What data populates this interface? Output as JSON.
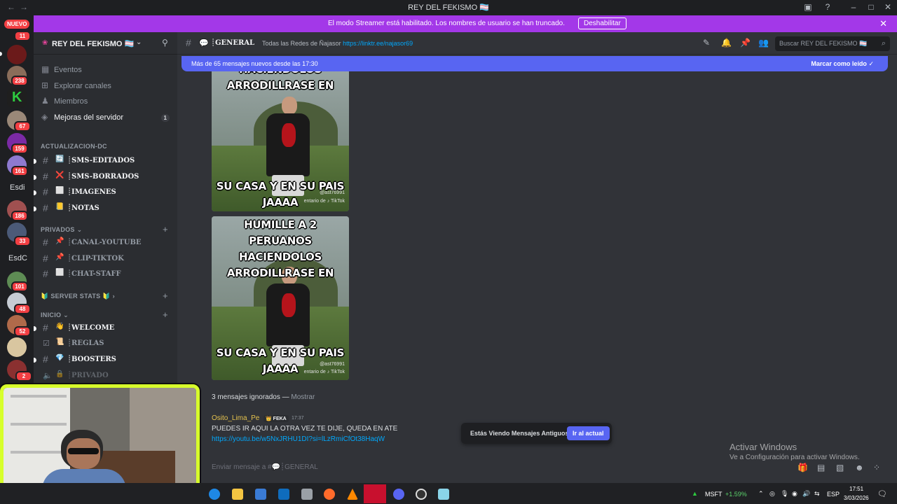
{
  "window": {
    "title": "REY DEL FEKISMO 🏳️‍⚧️"
  },
  "streamer_banner": {
    "message": "El modo Streamer está habilitado. Los nombres de usuario se han truncado.",
    "button": "Deshabilitar"
  },
  "guilds": {
    "new_label": "NUEVO",
    "badges": [
      "11",
      "238",
      "67",
      "159",
      "161",
      "186",
      "33",
      "101",
      "48",
      "52",
      "2"
    ],
    "text_icons": [
      "Esdi",
      "EsdC"
    ]
  },
  "server": {
    "name": "REY DEL FEKISMO 🏳️‍⚧️",
    "menu": [
      {
        "label": "Eventos",
        "icon": "calendar-icon"
      },
      {
        "label": "Explorar canales",
        "icon": "compass-icon"
      },
      {
        "label": "Miembros",
        "icon": "members-icon"
      },
      {
        "label": "Mejoras del servidor",
        "icon": "boost-icon",
        "badge": "1"
      }
    ],
    "categories": {
      "actualizacion": "ACTUALIZACION-DC",
      "privados": "PRIVADOS",
      "server_stats": "SERVER STATS",
      "inicio": "INICIO"
    },
    "channels_actualizacion": [
      {
        "emoji": "🔄",
        "label": "┊SMS-EDITADOS"
      },
      {
        "emoji": "❌",
        "label": "┊SMS-BORRADOS"
      },
      {
        "emoji": "⬜",
        "label": "┊IMAGENES"
      },
      {
        "emoji": "📒",
        "label": "┊NOTAS"
      }
    ],
    "channels_privados": [
      {
        "emoji": "📌",
        "label": "┊CANAL-YOUTUBE"
      },
      {
        "emoji": "📌",
        "label": "┊CLIP-TIKTOK"
      },
      {
        "emoji": "⬜",
        "label": "┊CHAT-STAFF"
      }
    ],
    "channels_inicio": [
      {
        "emoji": "👋",
        "label": "┊WELCOME"
      },
      {
        "emoji": "📜",
        "label": "┊REGLAS"
      },
      {
        "emoji": "💎",
        "label": "┊BOOSTERS"
      },
      {
        "emoji": "🔒",
        "label": "┊PRIVADO"
      }
    ]
  },
  "channel": {
    "name": "┊GENERAL",
    "topic_text": "Todas las Redes de Ñajasor",
    "topic_link": "https://linktr.ee/najasor69",
    "search_placeholder": "Buscar REY DEL FEKISMO 🏳️‍⚧️"
  },
  "new_messages": {
    "text": "Más de 65 mensajes nuevos desde las 17:30",
    "mark_read": "Marcar como leído"
  },
  "memes": [
    {
      "top_lines": [
        "HACIENDOLOS",
        "ARRODILLRASE EN"
      ],
      "bottom_lines": [
        "SU CASA Y EN SU PAIS",
        "JAAAA"
      ],
      "user": "@ast76991",
      "watermark": "entario de ♪ TikTok"
    },
    {
      "top_lines": [
        "HUMILLE A 2 PERUANOS",
        "HACIENDOLOS",
        "ARRODILLRASE EN"
      ],
      "bottom_lines": [
        "SU CASA Y EN SU PAIS",
        "JAAAA"
      ],
      "user": "@ast76991",
      "watermark": "entario de ♪ TikTok"
    }
  ],
  "ignored": {
    "text": "3 mensajes ignorados — ",
    "show": "Mostrar"
  },
  "message": {
    "author": "Osito_Lima_Pe",
    "tag": "FEKA",
    "time": "17:37",
    "text": "PUEDES IR AQUI LA OTRA VEZ TE DIJE, QUEDA EN ATE",
    "link": "https://youtu.be/w5NxJRHU1DI?si=lLzRmiCfOt38HaqW"
  },
  "old_messages_pill": {
    "text": "Estás Viendo Mensajes Antiguos",
    "button": "Ir al actual"
  },
  "composer": {
    "placeholder": "Enviar mensaje a #💬┊GENERAL"
  },
  "activate_windows": {
    "title": "Activar Windows",
    "subtitle": "Ve a Configuración para activar Windows."
  },
  "taskbar": {
    "stock": "MSFT",
    "stock_change": "+1.59%",
    "lang": "ESP",
    "time": "17:51",
    "date": "3/03/2026"
  },
  "colors": {
    "accent": "#5865f2",
    "banner": "#a338e8",
    "webcam_border": "#d7ff2b",
    "link": "#00a8fc",
    "danger": "#f23f43"
  }
}
